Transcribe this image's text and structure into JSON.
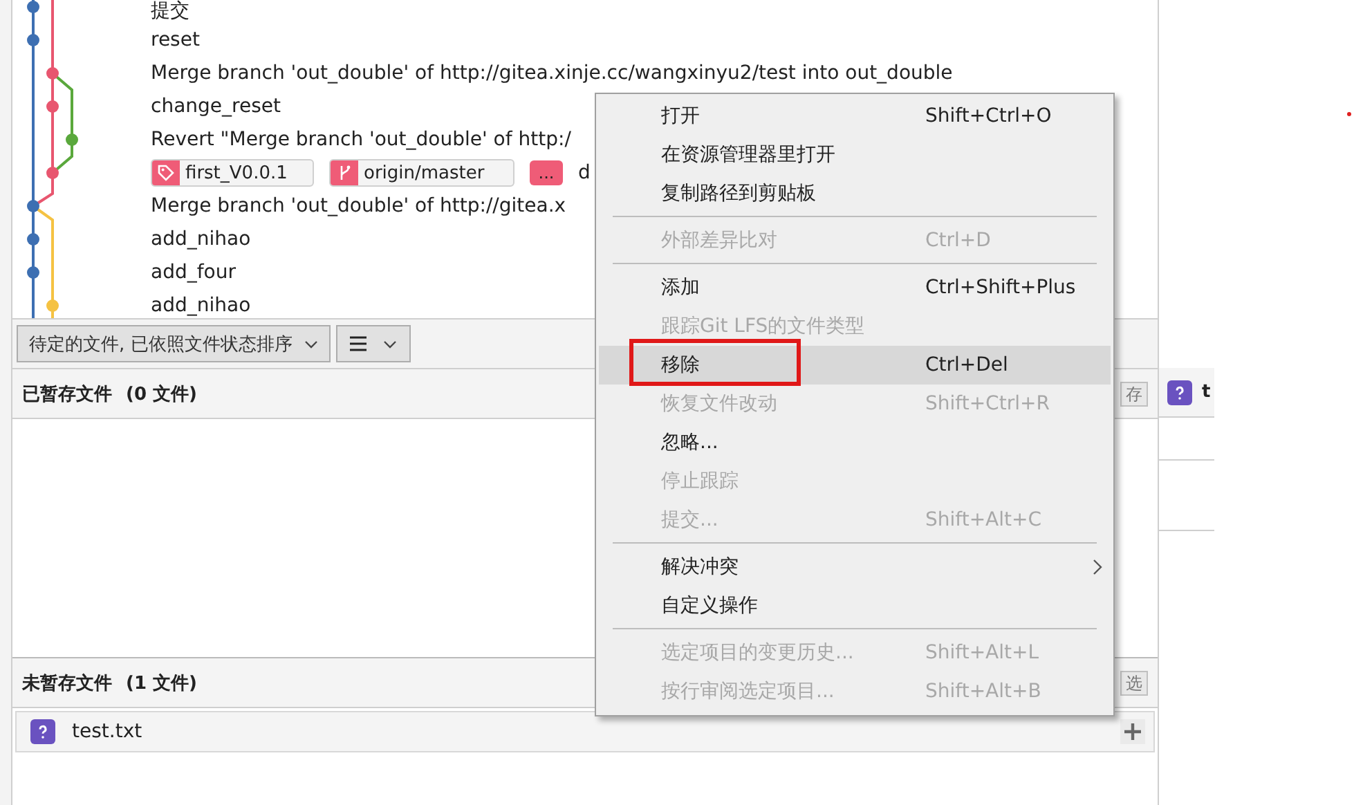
{
  "commits": [
    {
      "message": "提交",
      "color": "#3d6fb2"
    },
    {
      "message": "reset",
      "color": "#3d6fb2"
    },
    {
      "message": "Merge branch 'out_double' of http://gitea.xinje.cc/wangxinyu2/test into out_double",
      "color": "#e8566f"
    },
    {
      "message": "change_reset",
      "color": "#e8566f"
    },
    {
      "message": "Revert \"Merge branch 'out_double' of http:/",
      "color": "#5aa83c"
    },
    {
      "message": "d",
      "color": "#e8566f",
      "refs": [
        {
          "kind": "tag",
          "label": "first_V0.0.1"
        },
        {
          "kind": "branch",
          "label": "origin/master"
        },
        {
          "kind": "more",
          "label": "..."
        }
      ]
    },
    {
      "message": "Merge branch 'out_double' of http://gitea.x",
      "color": "#3d6fb2"
    },
    {
      "message": "add_nihao",
      "color": "#3d6fb2"
    },
    {
      "message": "add_four",
      "color": "#3d6fb2"
    },
    {
      "message": "add_nihao",
      "color": "#f5c242"
    }
  ],
  "toolbar": {
    "filter": "待定的文件, 已依照文件状态排序"
  },
  "staged": {
    "title": "已暂存文件",
    "count": "(0 文件)",
    "button": "存"
  },
  "unstaged": {
    "title": "未暂存文件",
    "count": "(1 文件)",
    "button": "选",
    "files": [
      {
        "name": "test.txt"
      }
    ]
  },
  "side_pane": {
    "title": "t"
  },
  "context_menu": [
    {
      "kind": "item",
      "label": "打开",
      "shortcut": "Shift+Ctrl+O",
      "disabled": false,
      "selected": false,
      "outlined": false
    },
    {
      "kind": "item",
      "label": "在资源管理器里打开",
      "disabled": false,
      "selected": false,
      "outlined": false
    },
    {
      "kind": "item",
      "label": "复制路径到剪贴板",
      "disabled": false,
      "selected": false,
      "outlined": false
    },
    {
      "kind": "separator"
    },
    {
      "kind": "item",
      "label": "外部差异比对",
      "shortcut": "Ctrl+D",
      "disabled": true,
      "selected": false,
      "outlined": false
    },
    {
      "kind": "separator"
    },
    {
      "kind": "item",
      "label": "添加",
      "shortcut": "Ctrl+Shift+Plus",
      "disabled": false,
      "selected": false,
      "outlined": false
    },
    {
      "kind": "item",
      "label": "跟踪Git LFS的文件类型",
      "disabled": true,
      "selected": false,
      "outlined": false
    },
    {
      "kind": "item",
      "label": "移除",
      "shortcut": "Ctrl+Del",
      "disabled": false,
      "selected": true,
      "outlined": true
    },
    {
      "kind": "item",
      "label": "恢复文件改动",
      "shortcut": "Shift+Ctrl+R",
      "disabled": true,
      "selected": false,
      "outlined": false
    },
    {
      "kind": "item",
      "label": "忽略...",
      "disabled": false,
      "selected": false,
      "outlined": false
    },
    {
      "kind": "item",
      "label": "停止跟踪",
      "disabled": true,
      "selected": false,
      "outlined": false
    },
    {
      "kind": "item",
      "label": "提交...",
      "shortcut": "Shift+Alt+C",
      "disabled": true,
      "selected": false,
      "outlined": false
    },
    {
      "kind": "separator"
    },
    {
      "kind": "submenu",
      "label": "解决冲突",
      "disabled": false,
      "selected": false,
      "outlined": false
    },
    {
      "kind": "item",
      "label": "自定义操作",
      "disabled": false,
      "selected": false,
      "outlined": false
    },
    {
      "kind": "separator"
    },
    {
      "kind": "item",
      "label": "选定项目的变更历史...",
      "shortcut": "Shift+Alt+L",
      "disabled": true,
      "selected": false,
      "outlined": false
    },
    {
      "kind": "item",
      "label": "按行审阅选定项目...",
      "shortcut": "Shift+Alt+B",
      "disabled": true,
      "selected": false,
      "outlined": false
    }
  ]
}
